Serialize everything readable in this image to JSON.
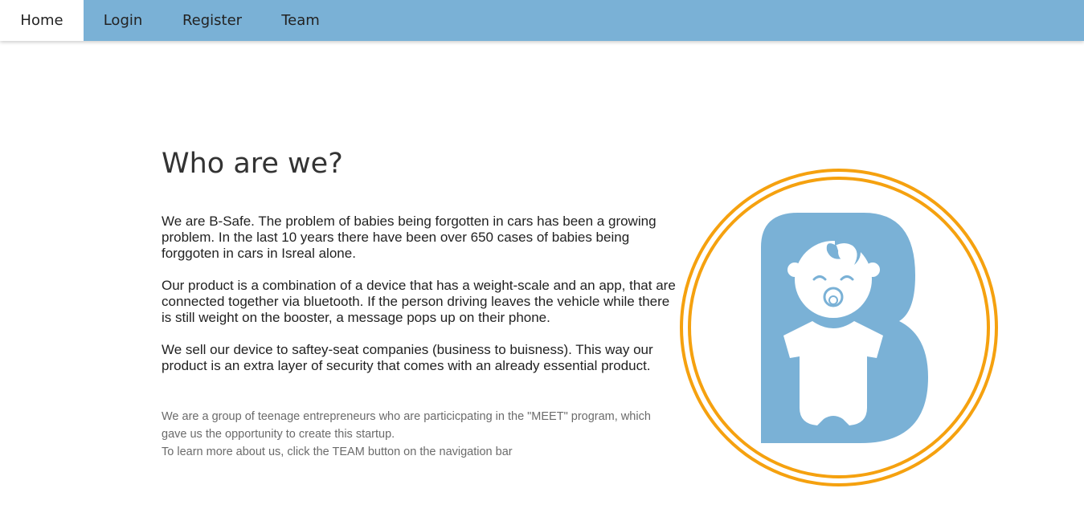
{
  "nav": {
    "home": "Home",
    "login": "Login",
    "register": "Register",
    "team": "Team"
  },
  "main": {
    "title": "Who are we?",
    "paragraphs": [
      "We are B-Safe. The problem of babies being forgotten in cars has been a growing problem. In the last 10 years there have been over 650 cases of babies being forggoten in cars in Isreal alone.",
      "Our product is a combination of a device that has a weight-scale and an app, that are connected together via bluetooth. If the person driving leaves the vehicle while there is still weight on the booster, a message pops up on their phone.",
      "We sell our device to saftey-seat companies (business to buisness). This way our product is an extra layer of security that comes with an already essential product."
    ],
    "note_lines": [
      "We are a group of teenage entrepreneurs who are particicpating in the \"MEET\" program, which gave us the opportunity to create this startup.",
      "To learn more about us, click the TEAM button on the navigation bar"
    ]
  },
  "logo": {
    "icon": "b-safe-baby-logo-icon"
  },
  "colors": {
    "nav_bg": "#7ab1d6",
    "logo_blue": "#7ab1d6",
    "ring_orange": "#f5a10f"
  }
}
